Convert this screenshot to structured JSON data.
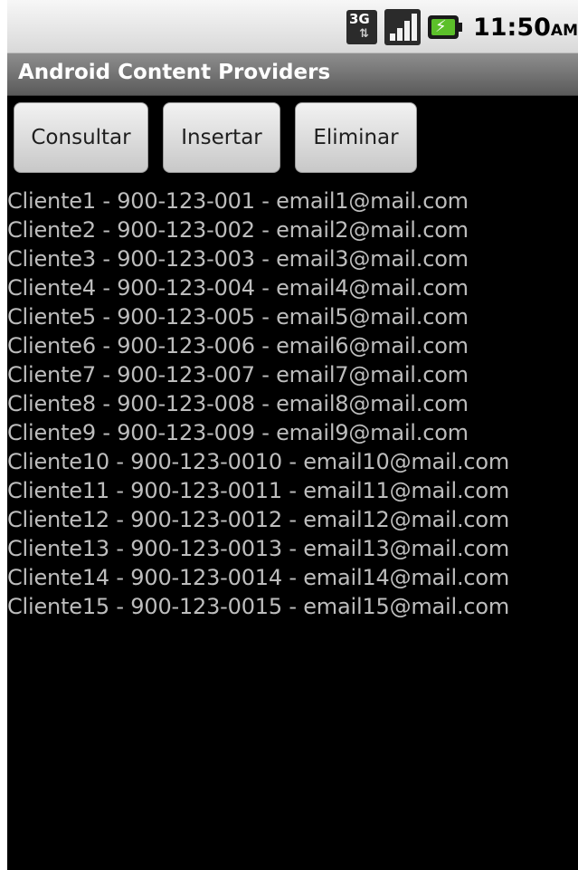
{
  "status_bar": {
    "network_label": "3G",
    "time": "11:50",
    "ampm": "AM",
    "icons": [
      "3g-data-icon",
      "signal-strength-icon",
      "battery-charging-icon"
    ]
  },
  "app": {
    "title": "Android Content Providers"
  },
  "buttons": {
    "query_label": "Consultar",
    "insert_label": "Insertar",
    "delete_label": "Eliminar"
  },
  "clients": [
    "Cliente1 - 900-123-001 - email1@mail.com",
    "Cliente2 - 900-123-002 - email2@mail.com",
    "Cliente3 - 900-123-003 - email3@mail.com",
    "Cliente4 - 900-123-004 - email4@mail.com",
    "Cliente5 - 900-123-005 - email5@mail.com",
    "Cliente6 - 900-123-006 - email6@mail.com",
    "Cliente7 - 900-123-007 - email7@mail.com",
    "Cliente8 - 900-123-008 - email8@mail.com",
    "Cliente9 - 900-123-009 - email9@mail.com",
    "Cliente10 - 900-123-0010 - email10@mail.com",
    "Cliente11 - 900-123-0011 - email11@mail.com",
    "Cliente12 - 900-123-0012 - email12@mail.com",
    "Cliente13 - 900-123-0013 - email13@mail.com",
    "Cliente14 - 900-123-0014 - email14@mail.com",
    "Cliente15 - 900-123-0015 - email15@mail.com"
  ],
  "colors": {
    "background": "#000000",
    "list_text": "#bdbdbd",
    "title_text": "#ffffff",
    "battery_fill": "#5cc02a"
  }
}
